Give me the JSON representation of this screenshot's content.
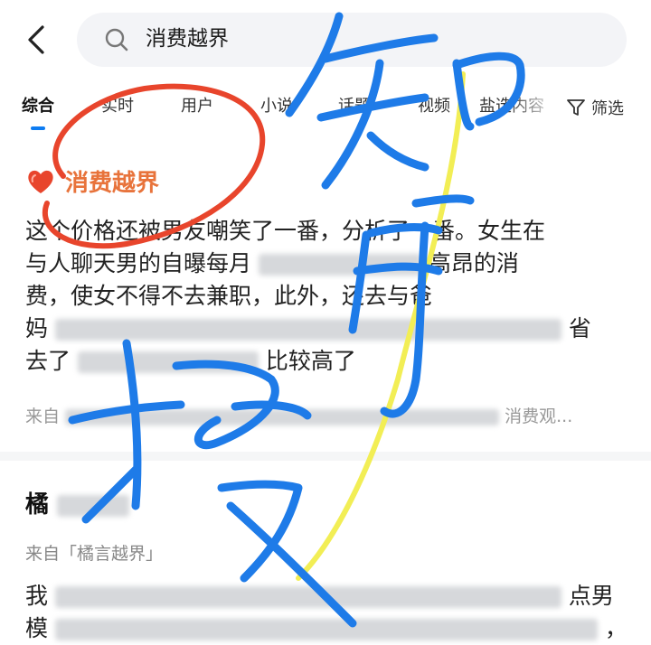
{
  "search": {
    "query": "消费越界"
  },
  "tabs": [
    {
      "label": "综合"
    },
    {
      "label": "实时"
    },
    {
      "label": "用户"
    },
    {
      "label": "小说"
    },
    {
      "label": "话题"
    },
    {
      "label": "视频"
    },
    {
      "label": "盐选内容"
    }
  ],
  "filter_label": "筛选",
  "result1": {
    "topic": "消费越界",
    "lines": [
      {
        "a": "这个价格还被男友嘲笑了一番，",
        "b": "分析了一番。女生在"
      },
      {
        "a": "与人聊天男的自曝每月",
        "b": "高昂的消"
      },
      {
        "a": "费，使女不得不去兼职，此外，",
        "b": "还去与爸"
      },
      {
        "a": "妈",
        "b": "省"
      },
      {
        "a": "去了",
        "b": "比较高了"
      }
    ],
    "meta": "来自",
    "meta_tail": "消费观..."
  },
  "result2": {
    "title": "橘",
    "from": "来自「橘言越界」",
    "lines": [
      {
        "a": "我",
        "b": "点男"
      },
      {
        "a": "模",
        "b": "，"
      }
    ]
  },
  "colors": {
    "accent": "#0d7cf2",
    "topic": "#e8733b",
    "scribble_blue": "#1e7be8",
    "scribble_red": "#e8452c",
    "scribble_yellow": "#f2ee55"
  }
}
